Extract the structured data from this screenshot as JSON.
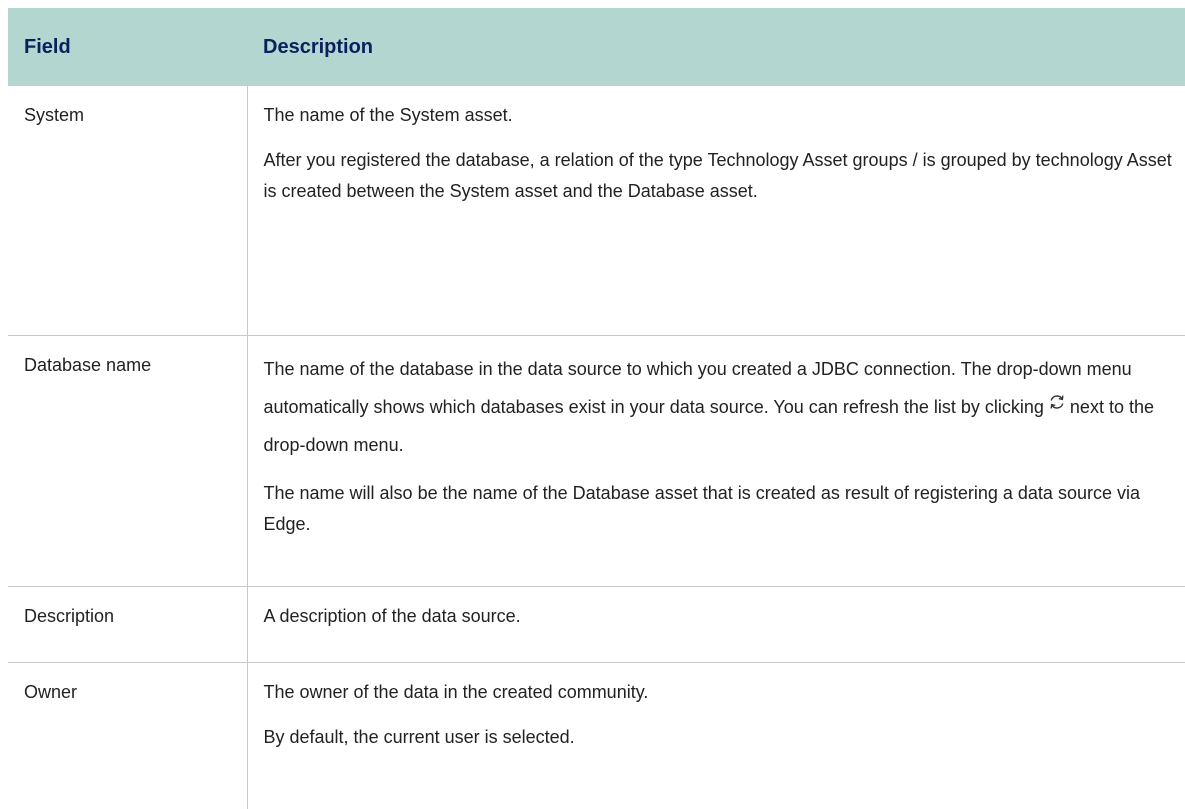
{
  "table": {
    "headers": [
      "Field",
      "Description"
    ],
    "rows": [
      {
        "field": "System",
        "paragraphs": [
          "The name of the System asset.",
          "After you registered the database, a relation of the type Technology Asset groups / is grouped by technology Asset is created between the System asset and the Database asset."
        ]
      },
      {
        "field": "Database name",
        "p1_before_icon": "The name of the database in the data source to which you created a JDBC connection. The drop-down menu automatically shows which databases exist in your data source. You can refresh the list by clicking",
        "p1_after_icon": "next to the drop-down menu.",
        "icon": "refresh-icon",
        "p2": "The name will also be the name of the Database asset that is created as result of registering a data source via Edge."
      },
      {
        "field": "Description",
        "paragraphs": [
          "A description of the data source."
        ]
      },
      {
        "field": "Owner",
        "paragraphs": [
          "The owner of the data in the created community.",
          "By default, the current user is selected."
        ]
      }
    ]
  },
  "colors": {
    "header_bg": "#b3d6d0",
    "header_text": "#0b1f5c",
    "border": "#c8c8c8"
  }
}
